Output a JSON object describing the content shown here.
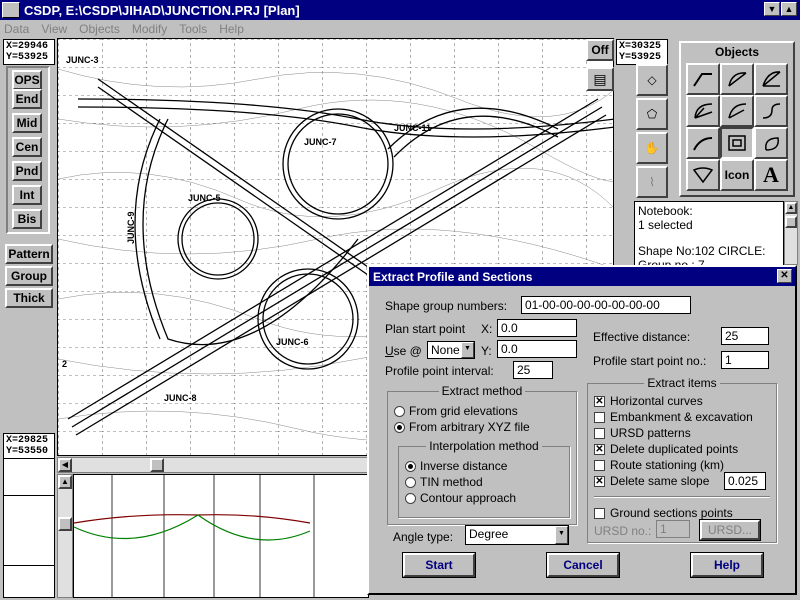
{
  "window": {
    "title": "CSDP, E:\\CSDP\\JIHAD\\JUNCTION.PRJ [Plan]"
  },
  "menu": [
    "Data",
    "View",
    "Objects",
    "Modify",
    "Tools",
    "Help"
  ],
  "coords": {
    "top_left": {
      "x": "X=29946",
      "y": "Y=53925"
    },
    "top_right": {
      "x": "X=30325",
      "y": "Y=53925"
    },
    "bottom_left": {
      "x": "X=29825",
      "y": "Y=53550"
    }
  },
  "snap": {
    "ops": "OPS",
    "buttons": [
      "End",
      "Mid",
      "Cen",
      "Pnd",
      "Int",
      "Bis"
    ]
  },
  "side": {
    "buttons": [
      "Pattern",
      "Group",
      "Thick"
    ]
  },
  "toolbar": {
    "off": "Off"
  },
  "objects": {
    "title": "Objects",
    "icon_label": "Icon",
    "text_label": "A"
  },
  "notebook": {
    "line1": "Notebook:",
    "line2": "1 selected",
    "line3": "Shape No:102 CIRCLE:",
    "line4": "Group no : 7"
  },
  "plan": {
    "labels": [
      "JUNC-3",
      "JUNC-7",
      "JUNC-11",
      "JUNC-5",
      "JUNC-9",
      "JUNC-6",
      "JUNC-8",
      "2"
    ]
  },
  "dialog": {
    "title": "Extract Profile and Sections",
    "shape_group_label": "Shape group numbers:",
    "shape_group_value": "01-00-00-00-00-00-00-00",
    "plan_start_label": "Plan start point",
    "x_label": "X:",
    "x_value": "0.0",
    "use_label": "Use @",
    "use_value": "None",
    "y_label": "Y:",
    "y_value": "0.0",
    "interval_label": "Profile point interval:",
    "interval_value": "25",
    "eff_label": "Effective distance:",
    "eff_value": "25",
    "pstart_label": "Profile start point no.:",
    "pstart_value": "1",
    "extract_method": {
      "title": "Extract method",
      "opt1": "From grid elevations",
      "opt2": "From arbitrary XYZ file"
    },
    "interp": {
      "title": "Interpolation method",
      "opt1": "Inverse distance",
      "opt2": "TIN method",
      "opt3": "Contour approach"
    },
    "items": {
      "title": "Extract items",
      "c1": "Horizontal curves",
      "c2": "Embankment & excavation",
      "c3": "URSD patterns",
      "c4": "Delete duplicated points",
      "c5": "Route stationing (km)",
      "c6": "Delete same slope",
      "slope_value": "0.025"
    },
    "ground_label": "Ground sections points",
    "ursd_no_label": "URSD no.:",
    "ursd_no_value": "1",
    "ursd_btn": "URSD...",
    "angle_label": "Angle type:",
    "angle_value": "Degree",
    "start": "Start",
    "cancel": "Cancel",
    "help": "Help"
  }
}
